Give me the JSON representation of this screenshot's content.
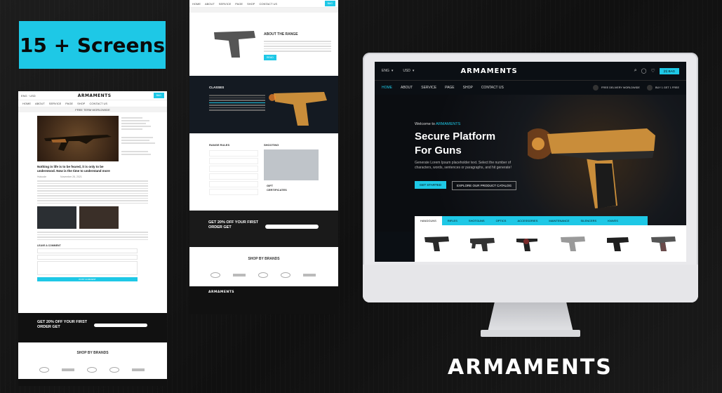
{
  "badge": "15 + Screens",
  "brand": "ARMAMENTS",
  "mock_blog": {
    "logo": "ARMAMENTS",
    "nav": [
      "HOME",
      "ABOUT",
      "SERVICE",
      "PAGE",
      "SHOP",
      "CONTACT US"
    ],
    "promo_bar": "FREE TERM WORLDWIDE",
    "post_title": "Nothing in life is to be feared, it is only to be understood. Now is the time to understand more",
    "author": "Hutcode",
    "date": "November 26, 2021",
    "leave_comment": "LEAVE A COMMENT",
    "submit": "POST COMMENT",
    "newsletter_title": "GET 20% OFF YOUR FIRST ORDER GET",
    "brands_title": "SHOP BY BRANDS"
  },
  "mock_range": {
    "nav": [
      "HOME",
      "ABOUT",
      "SERVICE",
      "PAGE",
      "SHOP",
      "CONTACT US"
    ],
    "about_title": "ABOUT THE RANGE",
    "classes_title": "CLASSES",
    "range_rules": "RANGE RULES",
    "shooting": "SHOOTING",
    "gift": "GIFT CERTIFICATES",
    "newsletter_title": "GET 20% OFF YOUR FIRST ORDER GET",
    "brands_title": "SHOP BY BRANDS",
    "footer_logo": "ARMAMENTS"
  },
  "screen": {
    "lang": "ENG",
    "currency": "USD",
    "logo": "ARMAMENTS",
    "cart": "(0) BAG",
    "nav": [
      "HOME",
      "ABOUT",
      "SERVICE",
      "PAGE",
      "SHOP",
      "CONTACT US"
    ],
    "free_delivery": "FREE DELIVERY WORLDWIDE",
    "buy_offer": "BUY 1 GET 1 FREE",
    "welcome_prefix": "Welcome to ",
    "welcome_brand": "ARMAMENTS",
    "headline_1": "Secure Platform",
    "headline_2": "For Guns",
    "lede": "Generate Lorem Ipsum placeholder text. Select the number of characters, words, sentences or paragraphs, and hit generate!",
    "cta_primary": "GET STARTED",
    "cta_secondary": "EXPLORE OUR PRODUCT CATALOG",
    "tabs": [
      "HANDGUNS",
      "RIFLES",
      "SHOTGUNS",
      "OPTICS",
      "ACCESSORIES",
      "MAINTENANCE",
      "SILENCERS",
      "KNIVES"
    ]
  },
  "colors": {
    "accent": "#1ec8e6",
    "dark": "#0b0f14",
    "gold": "#c98d3a"
  }
}
